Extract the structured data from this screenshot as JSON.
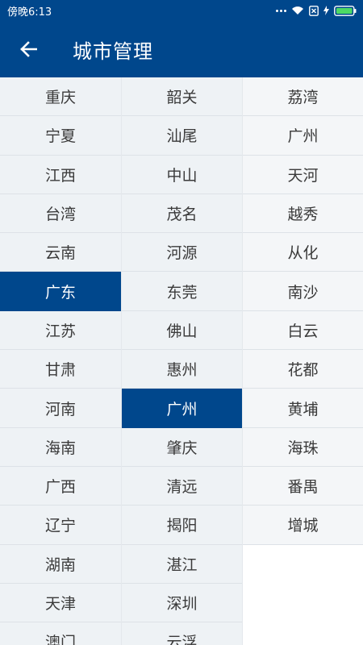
{
  "status_bar": {
    "time": "傍晚6:13"
  },
  "header": {
    "title": "城市管理",
    "back_icon": "arrow-left-icon"
  },
  "colors": {
    "primary": "#00478c",
    "cell_bg": "#eef2f5",
    "text": "#3a3a3a"
  },
  "provinces": {
    "selected": "广东",
    "items": [
      "重庆",
      "宁夏",
      "江西",
      "台湾",
      "云南",
      "广东",
      "江苏",
      "甘肃",
      "河南",
      "海南",
      "广西",
      "辽宁",
      "湖南",
      "天津",
      "澳门"
    ]
  },
  "cities": {
    "selected": "广州",
    "items": [
      "韶关",
      "汕尾",
      "中山",
      "茂名",
      "河源",
      "东莞",
      "佛山",
      "惠州",
      "广州",
      "肇庆",
      "清远",
      "揭阳",
      "湛江",
      "深圳",
      "云浮"
    ]
  },
  "districts": {
    "items": [
      "荔湾",
      "广州",
      "天河",
      "越秀",
      "从化",
      "南沙",
      "白云",
      "花都",
      "黄埔",
      "海珠",
      "番禺",
      "增城"
    ]
  }
}
